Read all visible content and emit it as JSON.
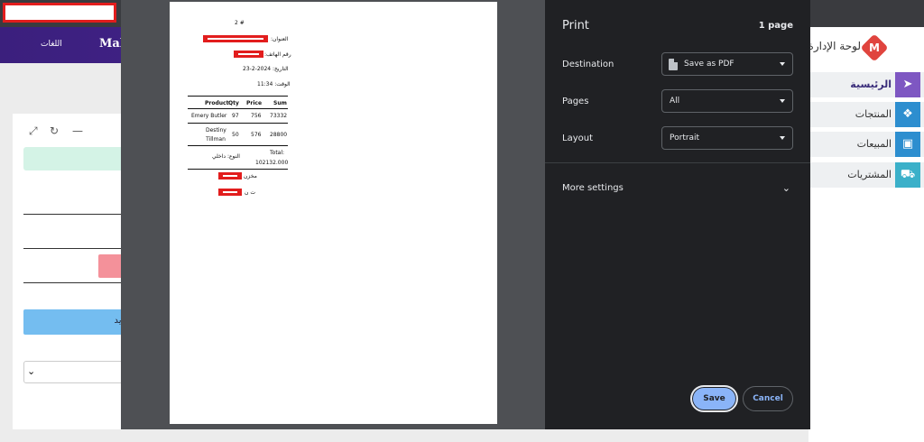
{
  "app": {
    "nav_links": [
      "اللغات",
      "Mahn"
    ],
    "brand_title": "لوحة الإدارة",
    "brand_letter": "M",
    "save_new_label": "جديد",
    "sidebar": [
      {
        "label": "الرئيسية",
        "icon": "cursor-icon",
        "color": "#7e57c2"
      },
      {
        "label": "المنتجات",
        "icon": "dropbox-icon",
        "color": "#2d8ecf"
      },
      {
        "label": "المبيعات",
        "icon": "cash-icon",
        "color": "#2d8ecf"
      },
      {
        "label": "المشتريات",
        "icon": "cart-plus-icon",
        "color": "#3bb0c9"
      }
    ]
  },
  "receipt": {
    "number": "# 2",
    "address_label": "العنوان:",
    "phone_label": "رقم الهاتف:",
    "date_line": "التاريخ: 2024-2-23",
    "time_line": "الوقت: 11:34",
    "headers": [
      "Product",
      "Qty",
      "Price",
      "Sum"
    ],
    "rows": [
      {
        "product": "Emery Butler",
        "qty": "97",
        "price": "756",
        "sum": "73332"
      },
      {
        "product": "Destiny Tillman",
        "qty": "50",
        "price": "576",
        "sum": "28800"
      }
    ],
    "type_line": "النوع: داخلي",
    "total_label": "Total:",
    "total_value": "102132.000",
    "footer_label_1": "مخزن",
    "footer_label_2": "ت ن"
  },
  "print": {
    "title": "Print",
    "page_count": "1 page",
    "destination_label": "Destination",
    "destination_value": "Save as PDF",
    "pages_label": "Pages",
    "pages_value": "All",
    "layout_label": "Layout",
    "layout_value": "Portrait",
    "more_settings": "More settings",
    "save_label": "Save",
    "cancel_label": "Cancel"
  }
}
